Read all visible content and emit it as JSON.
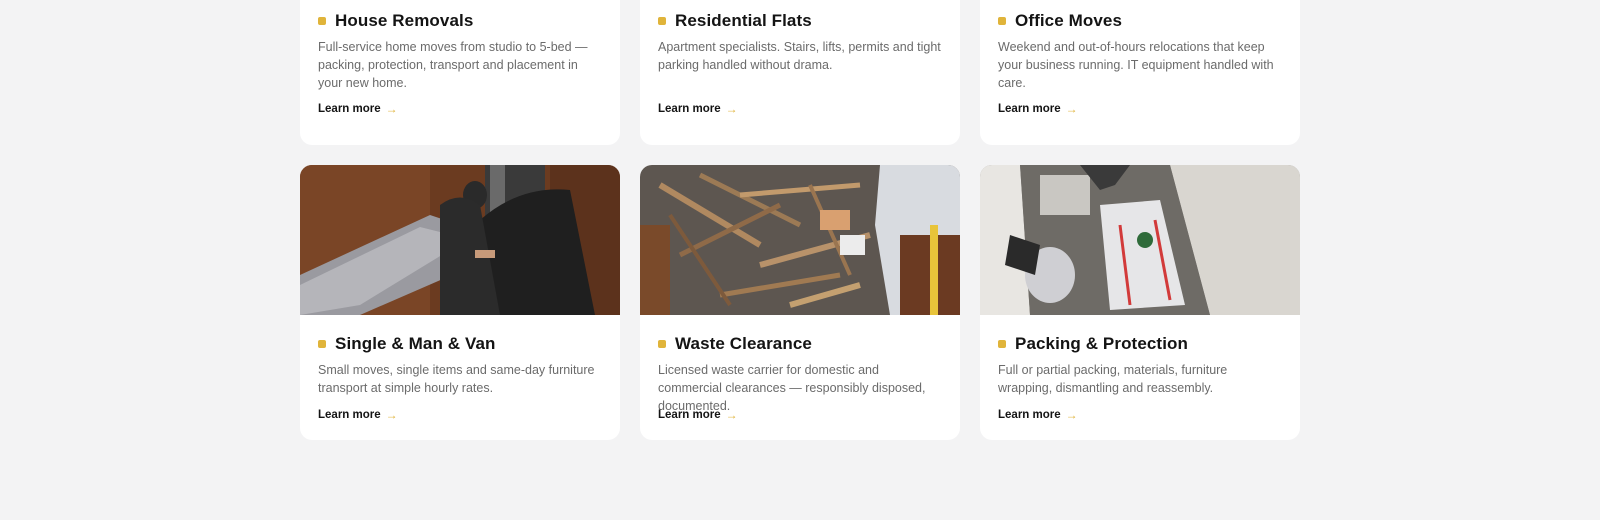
{
  "colors": {
    "accent": "#e0b43a",
    "page_background": "#f3f3f4",
    "card_background": "#ffffff"
  },
  "services": [
    {
      "title": "House Removals",
      "description": "Full-service home moves from studio to 5-bed — packing, protection, transport and placement in your new home.",
      "link": "Learn more"
    },
    {
      "title": "Residential Flats",
      "description": "Apartment specialists. Stairs, lifts, permits and tight parking handled without drama.",
      "link": "Learn more"
    },
    {
      "title": "Office Moves",
      "description": "Weekend and out-of-hours relocations that keep your business running. IT equipment handled with care.",
      "link": "Learn more"
    },
    {
      "title": "Single & Man & Van",
      "description": "Small moves, single items and same-day furniture transport at simple hourly rates.",
      "link": "Learn more",
      "photo": "movers wrapping furniture in van"
    },
    {
      "title": "Waste Clearance",
      "description": "Licensed waste carrier for domestic and commercial clearances — responsibly disposed, documented.",
      "link": "Learn more",
      "photo": "pile of wooden debris"
    },
    {
      "title": "Packing & Protection",
      "description": "Full or partial packing, materials, furniture wrapping, dismantling and reassembly.",
      "link": "Learn more",
      "photo": "furniture wrapped in plastic in hallway"
    }
  ]
}
